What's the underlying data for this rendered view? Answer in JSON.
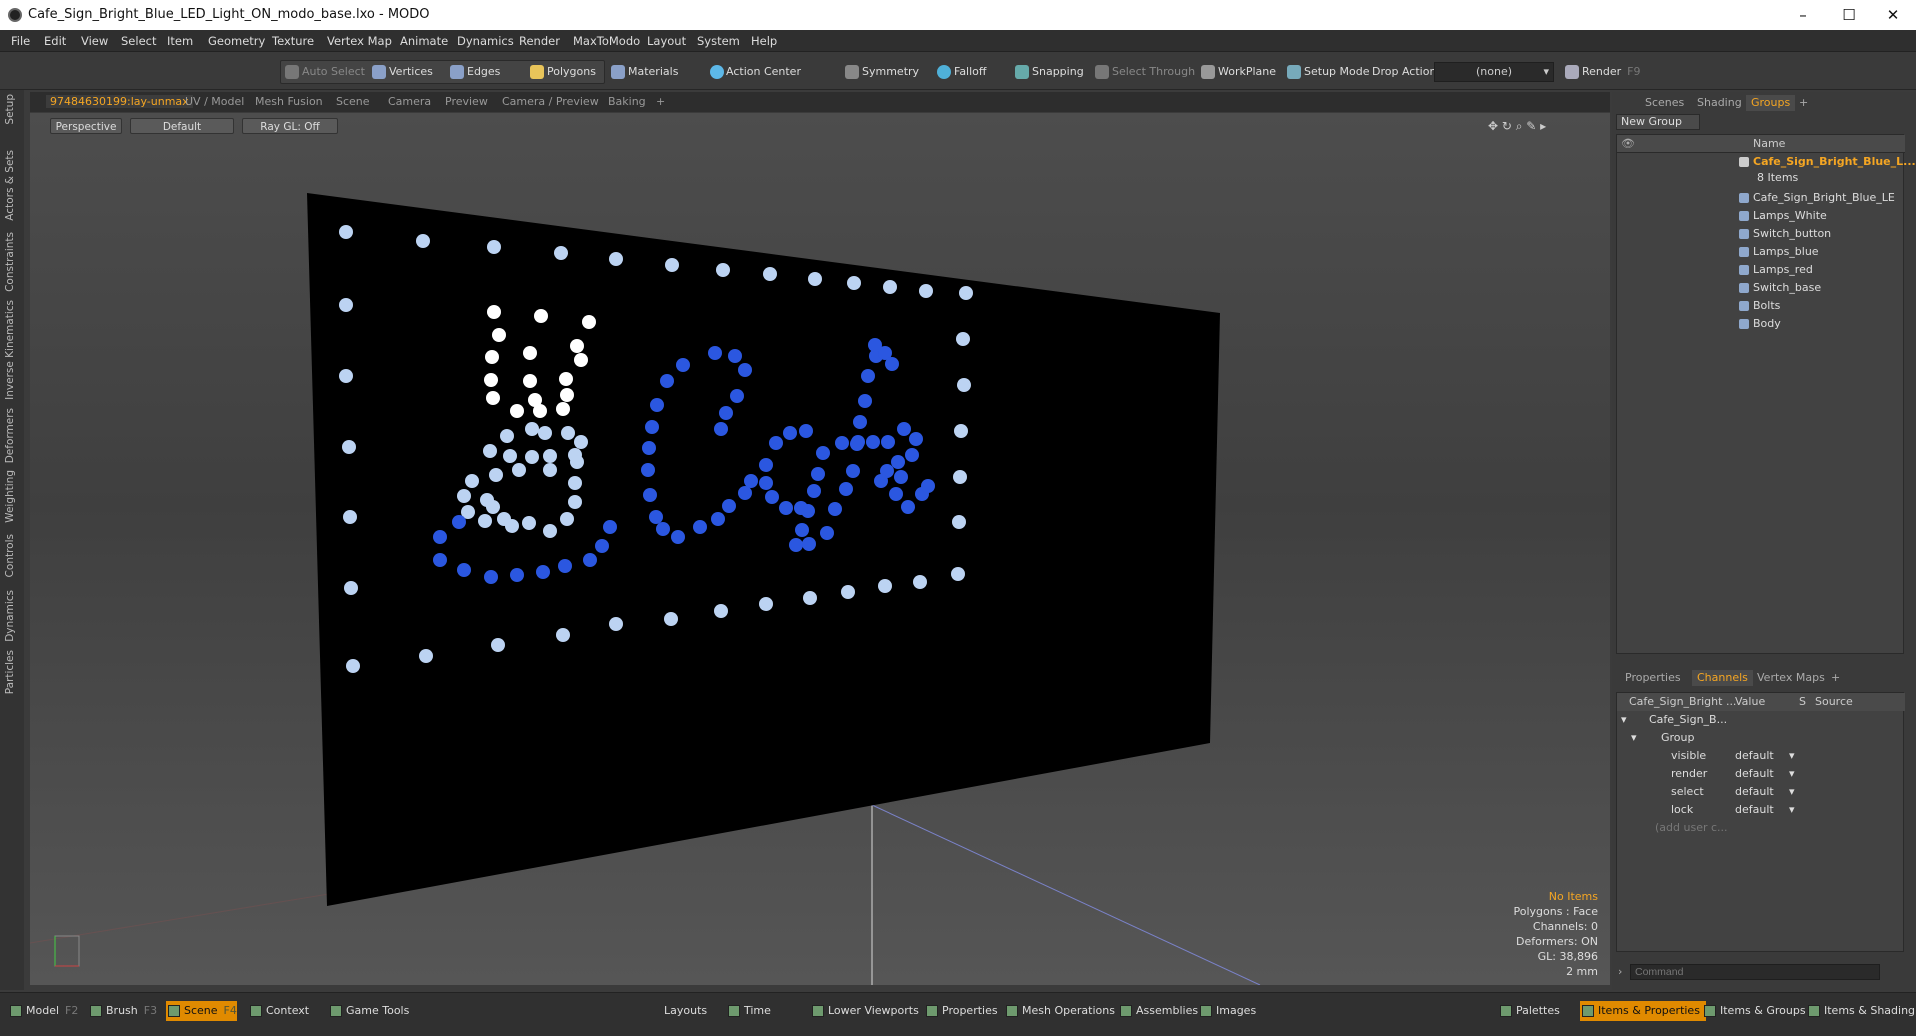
{
  "window": {
    "title": "Cafe_Sign_Bright_Blue_LED_Light_ON_modo_base.lxo - MODO",
    "minimize": "–",
    "maximize": "☐",
    "close": "✕"
  },
  "menu": [
    "File",
    "Edit",
    "View",
    "Select",
    "Item",
    "Geometry",
    "Texture",
    "Vertex Map",
    "Animate",
    "Dynamics",
    "Render",
    "MaxToModo",
    "Layout",
    "System",
    "Help"
  ],
  "toolbar": {
    "auto_select": "Auto Select",
    "vertices": "Vertices",
    "edges": "Edges",
    "polygons": "Polygons",
    "materials": "Materials",
    "action_center": "Action Center",
    "symmetry": "Symmetry",
    "falloff": "Falloff",
    "snapping": "Snapping",
    "select_through": "Select Through",
    "workplane": "WorkPlane",
    "setup_mode": "Setup Mode",
    "drop_action": "Drop Action",
    "drop_value": "(none)",
    "render": "Render",
    "render_key": "F9"
  },
  "left_tabs": [
    "Setup",
    "Actors & Sets",
    "Constraints",
    "Inverse Kinematics",
    "Deformers",
    "Weighting",
    "Controls",
    "Dynamics",
    "Particles"
  ],
  "viewport_tabs": [
    "97484630199:lay-unmax",
    "UV / Model",
    "Mesh Fusion",
    "Scene",
    "Camera",
    "Preview",
    "Camera / Preview",
    "Baking",
    "+"
  ],
  "viewport": {
    "view": "Perspective",
    "shading": "Default",
    "raygl": "Ray GL: Off",
    "info": {
      "items": "No Items",
      "polygons": "Polygons : Face",
      "channels": "Channels: 0",
      "deformers": "Deformers: ON",
      "gl": "GL: 38,896",
      "unit": "2 mm"
    }
  },
  "right_tabs": [
    "Scenes",
    "Shading",
    "Groups",
    "+"
  ],
  "groups": {
    "new_group": "New Group",
    "name_header": "Name",
    "root": "Cafe_Sign_Bright_Blue_L...",
    "count": "8 Items",
    "children": [
      "Cafe_Sign_Bright_Blue_LE ...",
      "Lamps_White",
      "Switch_button",
      "Lamps_blue",
      "Lamps_red",
      "Switch_base",
      "Bolts",
      "Body"
    ]
  },
  "props_tabs": [
    "Properties",
    "Channels",
    "Vertex Maps",
    "+"
  ],
  "channels": {
    "headers": [
      "Cafe_Sign_Bright ...",
      "Value",
      "S",
      "Source"
    ],
    "root": "Cafe_Sign_B...",
    "group": "Group",
    "rows": [
      {
        "name": "visible",
        "value": "default"
      },
      {
        "name": "render",
        "value": "default"
      },
      {
        "name": "select",
        "value": "default"
      },
      {
        "name": "lock",
        "value": "default"
      }
    ],
    "add": "(add user c..."
  },
  "command_placeholder": "Command",
  "bottom": {
    "left": [
      {
        "label": "Model",
        "key": "F2"
      },
      {
        "label": "Brush",
        "key": "F3"
      },
      {
        "label": "Scene",
        "key": "F4"
      },
      {
        "label": "Context",
        "key": ""
      },
      {
        "label": "Game Tools",
        "key": ""
      }
    ],
    "mid": [
      "Layouts",
      "Time",
      "Lower Viewports",
      "Properties",
      "Mesh Operations",
      "Assemblies",
      "Images"
    ],
    "right": [
      "Palettes",
      "Items & Properties",
      "Items & Groups",
      "Items & Shading"
    ]
  },
  "colors": {
    "accent": "#f5a623",
    "led_blue": "#2b57e0",
    "led_light": "#bcd3f2",
    "led_white": "#ffffff"
  }
}
